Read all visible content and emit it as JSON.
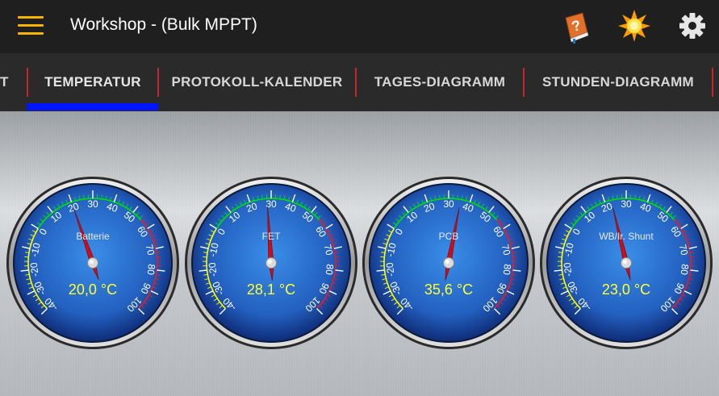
{
  "appbar": {
    "title": "Workshop - (Bulk MPPT)",
    "icons": [
      "menu-icon",
      "help-book-icon",
      "sun-icon",
      "gear-icon"
    ],
    "accent_color": "#f4b400"
  },
  "tabs": {
    "items": [
      {
        "label": "T"
      },
      {
        "label": "TEMPERATUR",
        "selected": true
      },
      {
        "label": "PROTOKOLL-KALENDER"
      },
      {
        "label": "TAGES-DIAGRAMM"
      },
      {
        "label": "STUNDEN-DIAGRAMM"
      }
    ],
    "indicator_color": "#0015ff",
    "separator_color": "#c0282a"
  },
  "gauges": [
    {
      "label": "Batterie",
      "value": 20.0,
      "display": "20,0 °C"
    },
    {
      "label": "FET",
      "value": 28.1,
      "display": "28,1 °C"
    },
    {
      "label": "PCB",
      "value": 35.6,
      "display": "35,6 °C"
    },
    {
      "label": "WB/Ir. Shunt",
      "value": 23.0,
      "display": "23,0 °C"
    }
  ],
  "scale": {
    "min": -40,
    "max": 100,
    "tick_labels": [
      "-40",
      "-30",
      "-20",
      "-10",
      "0",
      "10",
      "20",
      "30",
      "40",
      "50",
      "60",
      "70",
      "80",
      "90",
      "100"
    ],
    "zones": {
      "cold": [
        -40,
        0
      ],
      "normal": [
        0,
        55
      ],
      "hot": [
        55,
        100
      ]
    },
    "zone_colors": {
      "cold": "#ffff00",
      "normal": "#00e000",
      "hot": "#e0202a"
    }
  }
}
